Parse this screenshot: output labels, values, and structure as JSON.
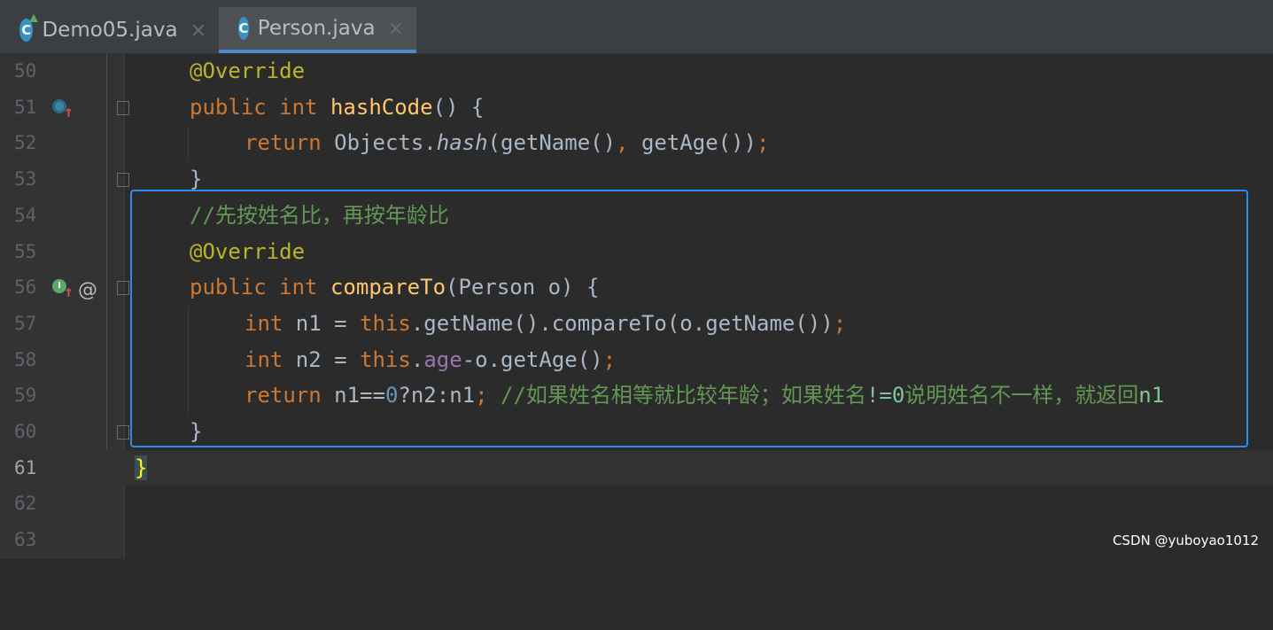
{
  "tabs": [
    {
      "label": "Demo05.java",
      "icon": "C",
      "active": false
    },
    {
      "label": "Person.java",
      "icon": "C",
      "active": true
    }
  ],
  "close_glyph": "×",
  "lines": [
    {
      "n": "50",
      "t1": "@Override"
    },
    {
      "n": "51",
      "k1": "public",
      "k2": "int",
      "f": "hashCode",
      "rest": "() {"
    },
    {
      "n": "52",
      "k1": "return",
      "a": "Objects.",
      "fi": "hash",
      "b": "(getName()",
      "c": ",",
      "d": " getAge())",
      "e": ";"
    },
    {
      "n": "53",
      "t1": "}"
    },
    {
      "n": "54",
      "cmt": "//先按姓名比，再按年龄比"
    },
    {
      "n": "55",
      "t1": "@Override"
    },
    {
      "n": "56",
      "k1": "public",
      "k2": "int",
      "f": "compareTo",
      "rest": "(Person o) {"
    },
    {
      "n": "57",
      "k1": "int",
      "a": " n1 = ",
      "k2": "this",
      "b": ".getName().compareTo(o.getName())",
      "e": ";"
    },
    {
      "n": "58",
      "k1": "int",
      "a": " n2 = ",
      "k2": "this",
      "dot": ".",
      "fld": "age",
      "b": "-o.getAge()",
      "e": ";"
    },
    {
      "n": "59",
      "k1": "return",
      "a": " n1==",
      "num": "0",
      "b": "?n2:n1",
      "e": ";",
      "cmt": " //如果姓名相等就比较年龄；如果姓名",
      "cmt_b": "!=0",
      "cmt_c": "说明姓名不一样，就返回",
      "cmt_d": "n1"
    },
    {
      "n": "60",
      "t1": "}"
    },
    {
      "n": "61",
      "t1": "}"
    },
    {
      "n": "62"
    },
    {
      "n": "63"
    }
  ],
  "gutter_at": "@",
  "watermark": "CSDN @yuboyao1012"
}
